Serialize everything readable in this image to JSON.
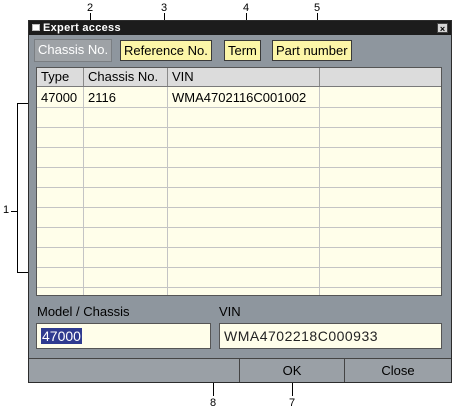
{
  "window": {
    "title": "Expert access",
    "close_glyph": "×"
  },
  "tabs": [
    {
      "label": "Chassis No.",
      "active": true
    },
    {
      "label": "Reference No.",
      "active": false
    },
    {
      "label": "Term",
      "active": false
    },
    {
      "label": "Part number",
      "active": false
    }
  ],
  "grid": {
    "columns": [
      "Type",
      "Chassis No.",
      "VIN",
      ""
    ],
    "rows": [
      [
        "47000",
        "2116",
        "WMA4702116C001002",
        ""
      ]
    ]
  },
  "form": {
    "model_label": "Model / Chassis",
    "model_value": "47000",
    "vin_label": "VIN",
    "vin_value": "WMA4702218C000933"
  },
  "buttons": {
    "blank": "",
    "ok": "OK",
    "close": "Close"
  },
  "callouts": [
    "1",
    "2",
    "3",
    "4",
    "5",
    "7",
    "8"
  ],
  "colors": {
    "tab_background": "#fcf6a8",
    "grid_background": "#fffeea",
    "window_background": "#8e969e",
    "selection": "#2f3b8f"
  }
}
